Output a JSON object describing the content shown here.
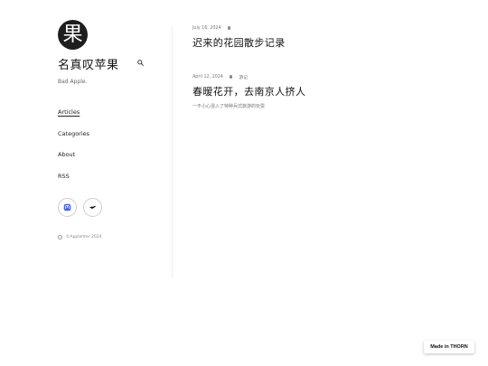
{
  "site": {
    "logo_char": "果",
    "title": "名真叹苹果",
    "tagline": "Bad Apple."
  },
  "nav": {
    "items": [
      {
        "label": "Articles",
        "active": true
      },
      {
        "label": "Categories",
        "active": false
      },
      {
        "label": "About",
        "active": false
      },
      {
        "label": "RSS",
        "active": false
      }
    ]
  },
  "social": {
    "icons": [
      "mastodon-icon",
      "bird-icon"
    ]
  },
  "footer": {
    "copyright": "©Applehter 2024"
  },
  "posts": [
    {
      "date": "July 16, 2024",
      "category": "",
      "title": "迟来的花园散步记录",
      "excerpt": ""
    },
    {
      "date": "April 12, 2024",
      "category": "游记",
      "title": "春暧花开，去南京人挤人",
      "excerpt": "一不小心混入了特种兵式旅游的玩耍"
    }
  ],
  "badge": {
    "label": "Made in THORN"
  },
  "colors": {
    "logo_bg": "#1e1e1e",
    "text": "#111111",
    "muted": "#777777",
    "divider": "#eeeeee"
  }
}
